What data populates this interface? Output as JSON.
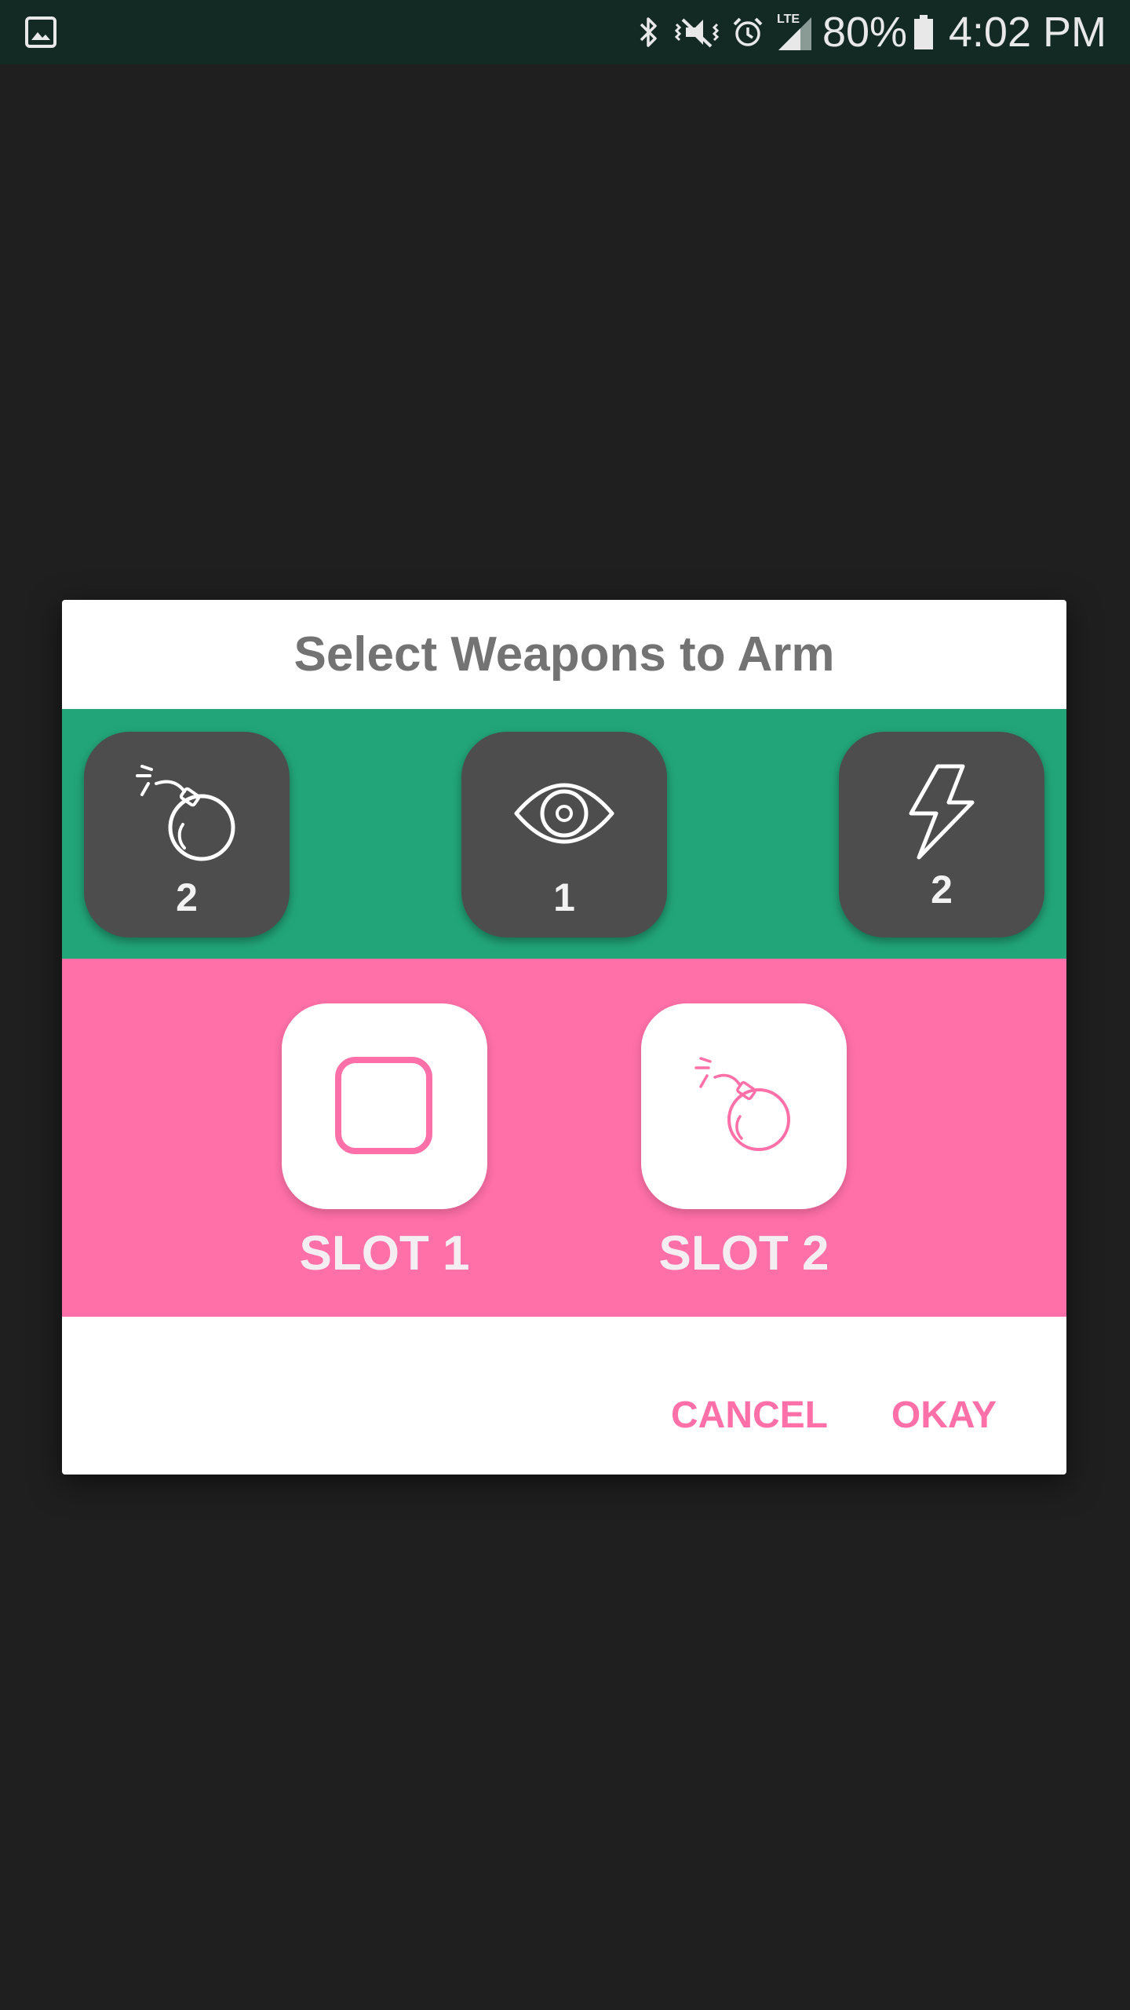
{
  "status_bar": {
    "battery_percent": "80%",
    "time": "4:02 PM",
    "network_label": "LTE",
    "icons": [
      "image-notification-icon",
      "bluetooth-icon",
      "vibrate-mute-icon",
      "alarm-icon",
      "signal-icon",
      "battery-icon"
    ]
  },
  "dialog": {
    "title": "Select Weapons to Arm",
    "weapons": [
      {
        "icon": "bomb-icon",
        "count": "2"
      },
      {
        "icon": "eye-icon",
        "count": "1"
      },
      {
        "icon": "lightning-icon",
        "count": "2"
      }
    ],
    "slots": [
      {
        "label": "SLOT 1",
        "icon": "empty-slot-icon"
      },
      {
        "label": "SLOT 2",
        "icon": "bomb-icon"
      }
    ],
    "cancel_label": "CANCEL",
    "okay_label": "OKAY"
  },
  "colors": {
    "status_bar_bg": "#132a24",
    "background": "#1f1f1f",
    "weapons_strip": "#22a679",
    "slots_strip": "#ff70a8",
    "tile_dark": "#4d4d4d",
    "accent": "#ff70a8"
  }
}
